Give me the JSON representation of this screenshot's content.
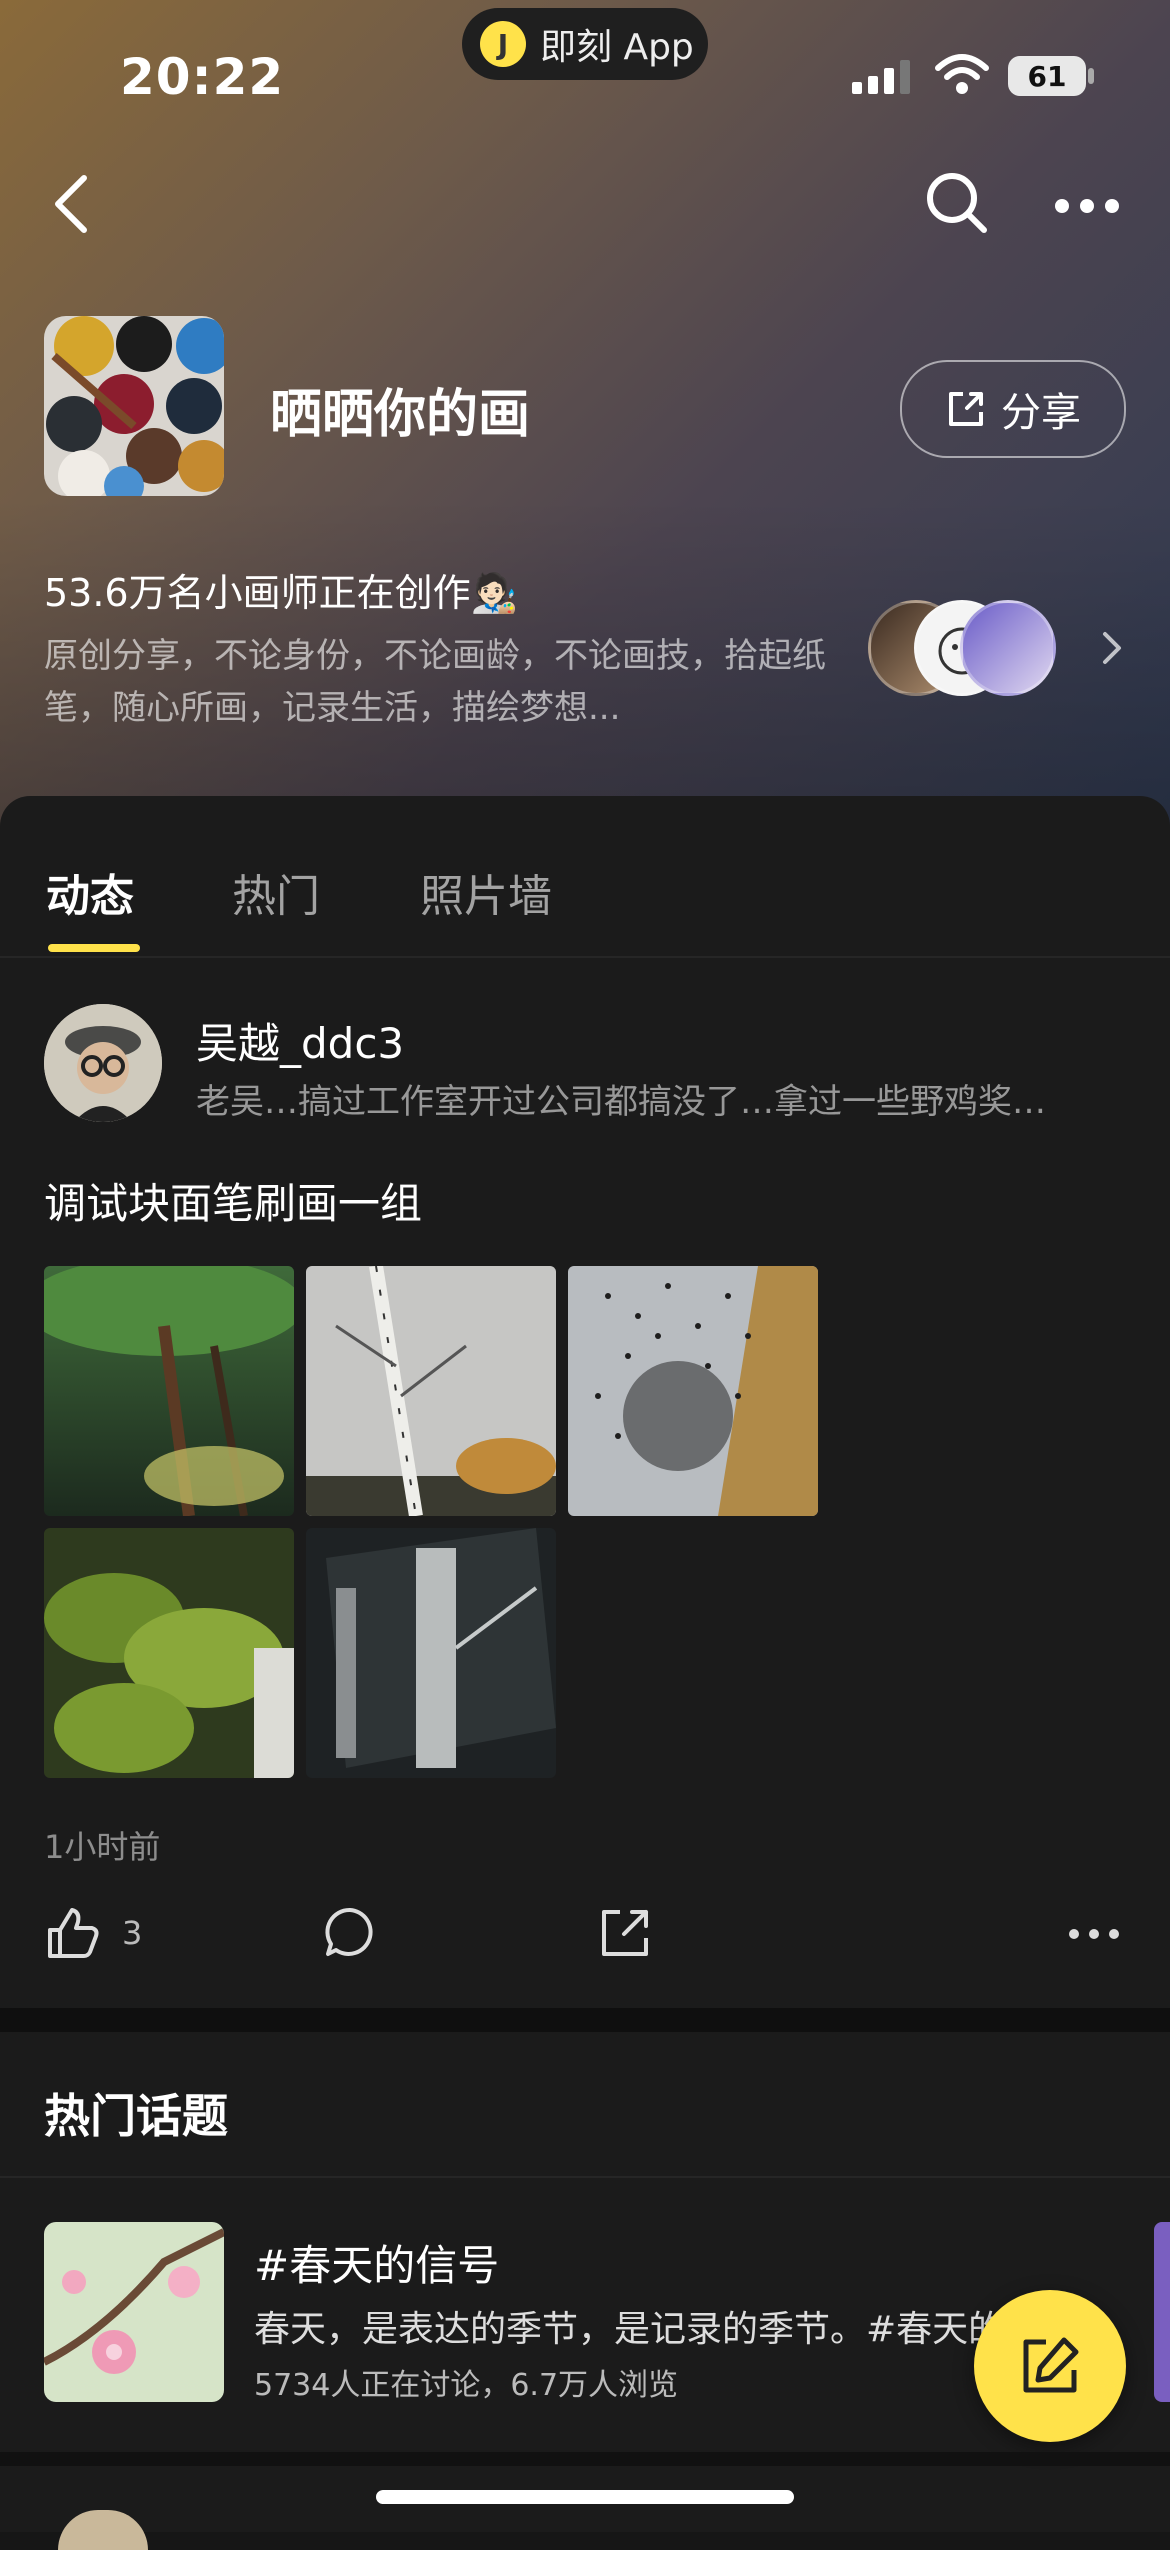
{
  "status_bar": {
    "time": "20:22",
    "app_pill": "即刻 App",
    "battery": "61"
  },
  "topic": {
    "title": "晒晒你的画",
    "share_label": "分享",
    "member_count": "53.6万名小画师正在创作🧑🏻‍🎨",
    "description": "原创分享，不论身份，不论画龄，不论画技，拾起纸笔，随心所画，记录生活，描绘梦想..."
  },
  "tabs": [
    {
      "label": "动态",
      "active": true
    },
    {
      "label": "热门",
      "active": false
    },
    {
      "label": "照片墙",
      "active": false
    }
  ],
  "post": {
    "author": "吴越_ddc3",
    "bio": "老吴…搞过工作室开过公司都搞没了…拿过一些野鸡奖…",
    "text": "调试块面笔刷画一组",
    "images": [
      "forest-painting",
      "birch-painting",
      "birds-tree-painting",
      "mossy-rocks-painting",
      "dark-trees-painting"
    ],
    "time": "1小时前",
    "likes": "3"
  },
  "hot_topics": {
    "title": "热门话题",
    "items": [
      {
        "name": "#春天的信号",
        "desc": "春天，是表达的季节，是记录的季节。#春天的信号",
        "stats": "5734人正在讨论，6.7万人浏览"
      }
    ]
  },
  "colors": {
    "accent": "#ffe24a",
    "background": "#161616",
    "card": "#1b1b1b"
  },
  "icons": [
    "back-icon",
    "search-icon",
    "more-icon",
    "share-icon",
    "chevron-right-icon",
    "like-icon",
    "comment-icon",
    "edit-icon"
  ]
}
